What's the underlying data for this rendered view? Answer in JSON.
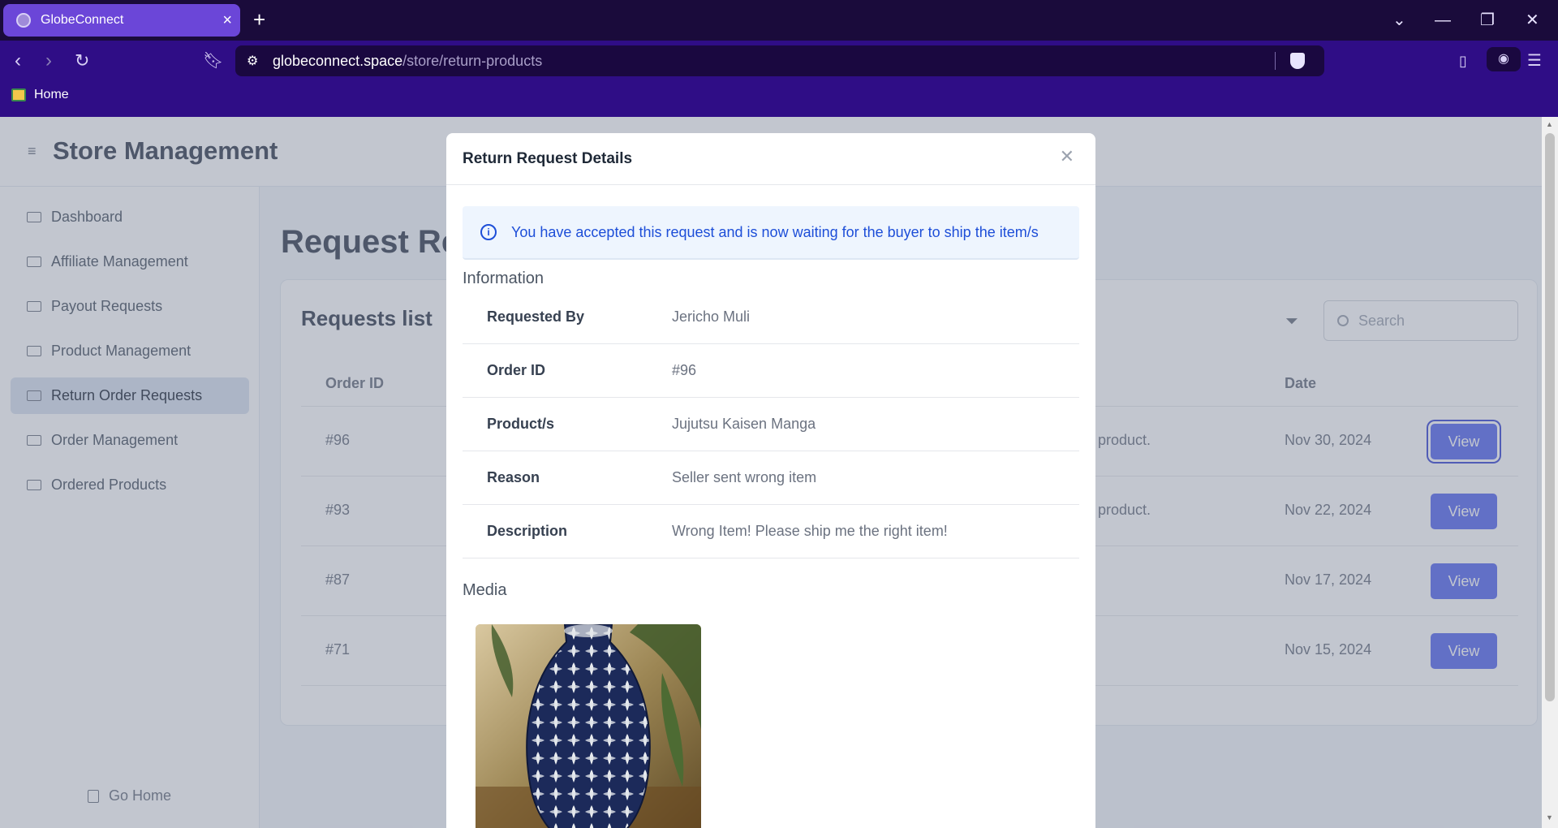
{
  "browser": {
    "tab_title": "GlobeConnect",
    "url_domain": "globeconnect.space",
    "url_path": "/store/return-products",
    "bookmark": "Home"
  },
  "app": {
    "title": "Store Management",
    "sidebar": {
      "items": [
        {
          "label": "Dashboard",
          "active": false
        },
        {
          "label": "Affiliate Management",
          "active": false
        },
        {
          "label": "Payout Requests",
          "active": false
        },
        {
          "label": "Product Management",
          "active": false
        },
        {
          "label": "Return Order Requests",
          "active": true
        },
        {
          "label": "Order Management",
          "active": false
        },
        {
          "label": "Ordered Products",
          "active": false
        }
      ],
      "go_home": "Go Home"
    },
    "page_title": "Request Ret",
    "card": {
      "title": "Requests list",
      "search_placeholder": "Search",
      "columns": [
        "Order ID",
        "Date"
      ],
      "rows": [
        {
          "id": "#96",
          "message": "product.",
          "date": "Nov 30, 2024",
          "action": "View"
        },
        {
          "id": "#93",
          "message": "product.",
          "date": "Nov 22, 2024",
          "action": "View"
        },
        {
          "id": "#87",
          "message": "",
          "date": "Nov 17, 2024",
          "action": "View"
        },
        {
          "id": "#71",
          "message": "",
          "date": "Nov 15, 2024",
          "action": "View"
        }
      ]
    }
  },
  "modal": {
    "title": "Return Request Details",
    "alert": "You have accepted this request and is now waiting for the buyer to ship the item/s",
    "info_heading": "Information",
    "info": [
      {
        "label": "Requested By",
        "value": "Jericho Muli"
      },
      {
        "label": "Order ID",
        "value": "#96"
      },
      {
        "label": "Product/s",
        "value": "Jujutsu Kaisen Manga"
      },
      {
        "label": "Reason",
        "value": "Seller sent wrong item"
      },
      {
        "label": "Description",
        "value": "Wrong Item! Please ship me the right item!"
      }
    ],
    "media_heading": "Media"
  },
  "colors": {
    "accent": "#5b6cf0",
    "browser_tab": "#6b46d8",
    "browser_toolbar": "#2f0d86",
    "alert_text": "#1d4ed8"
  }
}
